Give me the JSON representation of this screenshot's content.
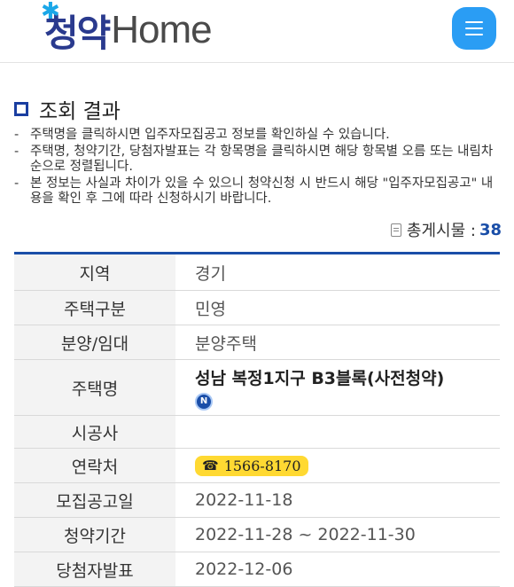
{
  "header": {
    "logo_ko": "청약",
    "logo_en": "Home"
  },
  "section": {
    "title": "조회 결과"
  },
  "notes": [
    "주택명을 클릭하시면 입주자모집공고 정보를 확인하실 수 있습니다.",
    "주택명, 청약기간, 당첨자발표는 각 항목명을 클릭하시면 해당 항목별 오름 또는 내림차순으로 정렬됩니다.",
    "본 정보는 사실과 차이가 있을 수 있으니 청약신청 시 반드시 해당 \"입주자모집공고\" 내용을 확인 후 그에 따라 신청하시기 바랍니다."
  ],
  "total": {
    "label": "총게시물 :",
    "count": "38"
  },
  "table": {
    "rows": [
      {
        "label": "지역",
        "value": "경기"
      },
      {
        "label": "주택구분",
        "value": "민영"
      },
      {
        "label": "분양/임대",
        "value": "분양주택"
      },
      {
        "label": "주택명",
        "value": "성남 복정1지구 B3블록(사전청약)",
        "badge": "N"
      },
      {
        "label": "시공사",
        "value": ""
      },
      {
        "label": "연락처",
        "value": "1566-8170"
      },
      {
        "label": "모집공고일",
        "value": "2022-11-18"
      },
      {
        "label": "청약기간",
        "value": "2022-11-28 ~ 2022-11-30"
      },
      {
        "label": "당첨자발표",
        "value": "2022-12-06"
      }
    ]
  },
  "colors": {
    "accent": "#1a4ea8",
    "menu_button": "#2a9df4",
    "phone_badge": "#ffd932"
  }
}
